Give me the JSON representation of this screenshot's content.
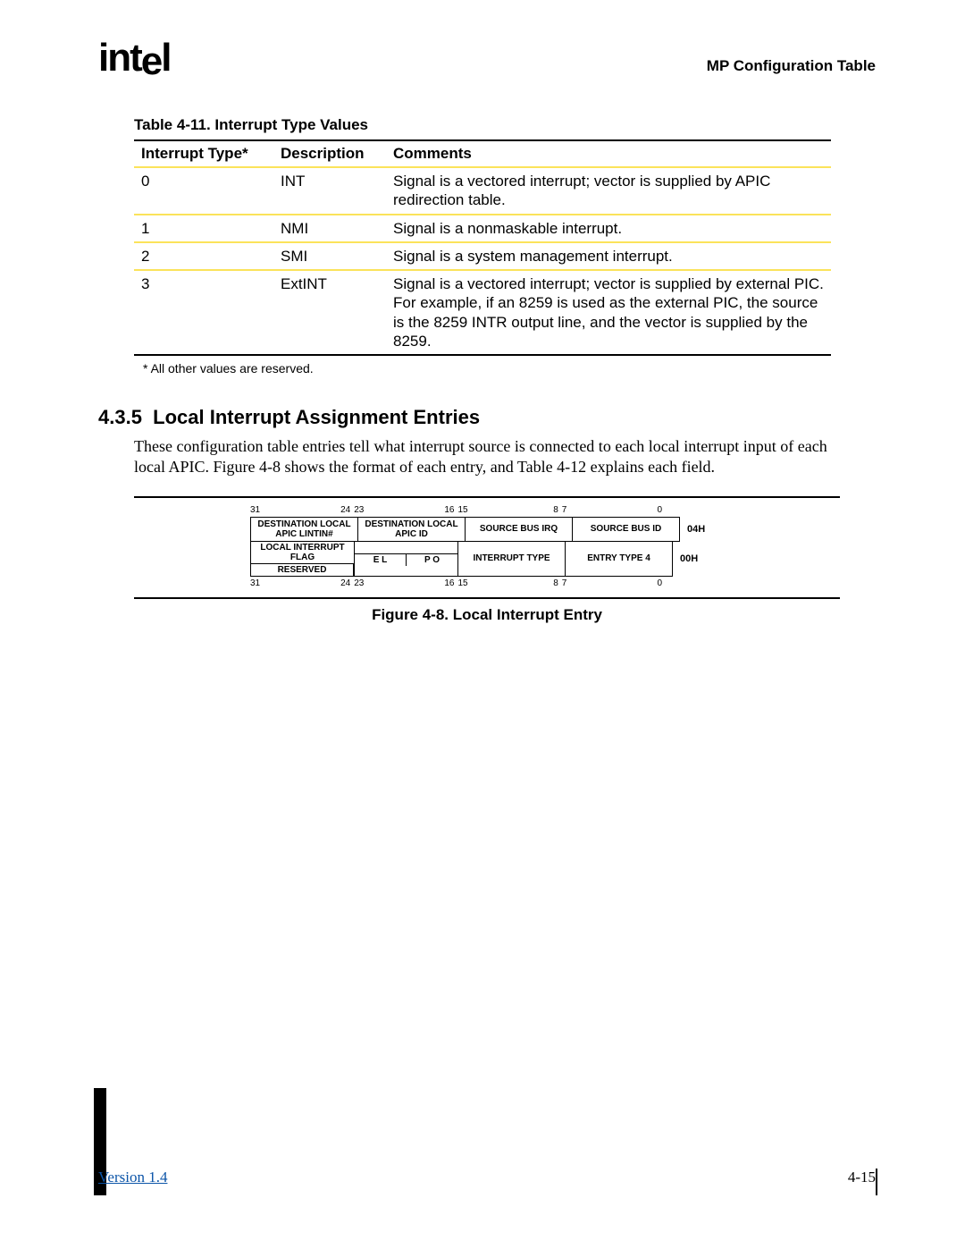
{
  "header": {
    "logo": "intel",
    "right": "MP Configuration Table"
  },
  "table": {
    "caption": "Table 4-11.  Interrupt Type Values",
    "headers": [
      "Interrupt Type*",
      "Description",
      "Comments"
    ],
    "rows": [
      {
        "type": "0",
        "desc": "INT",
        "comment": "Signal is a vectored interrupt; vector is supplied by APIC redirection table."
      },
      {
        "type": "1",
        "desc": "NMI",
        "comment": "Signal is a nonmaskable interrupt."
      },
      {
        "type": "2",
        "desc": "SMI",
        "comment": "Signal is a system management interrupt."
      },
      {
        "type": "3",
        "desc": "ExtINT",
        "comment": "Signal is a vectored interrupt; vector is supplied by external PIC. For example, if an 8259 is used as the external PIC, the source is the 8259 INTR output line, and the vector is supplied by the 8259."
      }
    ],
    "footnote": "*   All other values are reserved."
  },
  "section": {
    "number": "4.3.5",
    "title": "Local Interrupt Assignment Entries",
    "body": "These configuration table entries tell what interrupt source is connected to each local interrupt input of each local APIC.  Figure 4-8 shows the format of each entry, and Table 4-12 explains each field."
  },
  "figure": {
    "bits_top": [
      "31",
      "24",
      "23",
      "16",
      "15",
      "8",
      "7",
      "0"
    ],
    "row1": {
      "cells": [
        "DESTINATION LOCAL APIC LINTIN#",
        "DESTINATION LOCAL APIC ID",
        "SOURCE BUS IRQ",
        "SOURCE BUS ID"
      ],
      "offset": "04H"
    },
    "row2": {
      "flag_label": "LOCAL INTERRUPT FLAG",
      "reserved_label": "RESERVED",
      "el": "E L",
      "po": "P O",
      "cells": [
        "INTERRUPT TYPE",
        "ENTRY TYPE 4"
      ],
      "offset": "00H"
    },
    "bits_bot": [
      "31",
      "24",
      "23",
      "16",
      "15",
      "8",
      "7",
      "0"
    ],
    "caption": "Figure 4-8.  Local Interrupt Entry"
  },
  "footer": {
    "version": "Version 1.4",
    "page": "4-15"
  }
}
